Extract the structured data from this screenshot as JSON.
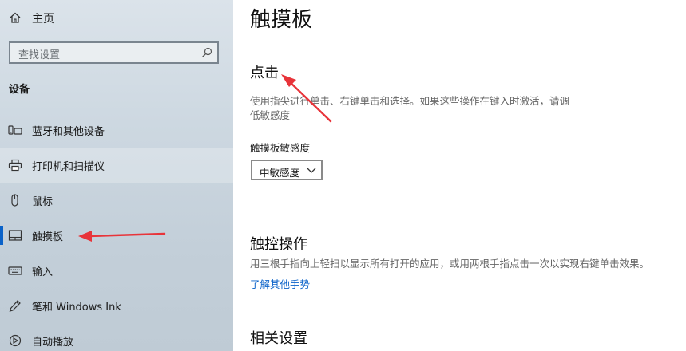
{
  "sidebar": {
    "home_label": "主页",
    "search_placeholder": "查找设置",
    "section_title": "设备",
    "items": [
      {
        "label": "蓝牙和其他设备"
      },
      {
        "label": "打印机和扫描仪"
      },
      {
        "label": "鼠标"
      },
      {
        "label": "触摸板"
      },
      {
        "label": "输入"
      },
      {
        "label": "笔和 Windows Ink"
      },
      {
        "label": "自动播放"
      }
    ]
  },
  "main": {
    "title": "触摸板",
    "tap": {
      "heading": "点击",
      "desc_line1": "使用指尖进行单击、右键单击和选择。如果这些操作在键入时激活，请调",
      "desc_line2": "低敏感度",
      "sensitivity_label": "触摸板敏感度",
      "sensitivity_value": "中敏感度"
    },
    "gestures": {
      "heading": "触控操作",
      "desc": "用三根手指向上轻扫以显示所有打开的应用，或用两根手指点击一次以实现右键单击效果。",
      "link": "了解其他手势"
    },
    "related": {
      "heading": "相关设置"
    }
  },
  "colors": {
    "accent": "#0a62c9",
    "annotation_arrow": "#e8343a"
  }
}
